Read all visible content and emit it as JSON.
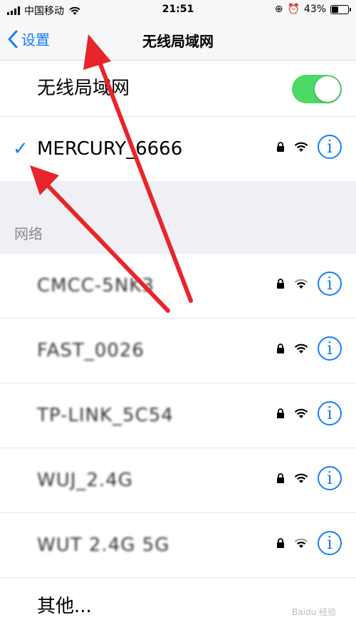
{
  "status_bar": {
    "carrier": "中国移动",
    "time": "21:51",
    "battery": "43%",
    "battery_level": 0.43
  },
  "nav": {
    "back_label": "设置",
    "title": "无线局域网"
  },
  "wifi_toggle": {
    "label": "无线局域网",
    "on": true
  },
  "connected": {
    "name": "MERCURY_6666",
    "check": "✓"
  },
  "section_header": "网络",
  "networks": [
    {
      "name": "CMCC-5NK3"
    },
    {
      "name": "FAST_0026"
    },
    {
      "name": "TP-LINK_5C54"
    },
    {
      "name": "WUJ_2.4G"
    },
    {
      "name": "WUT 2.4G 5G"
    }
  ],
  "other_label": "其他...",
  "watermark": "Baidu 经验",
  "colors": {
    "accent": "#147efb",
    "toggle_on": "#4cd964",
    "arrow": "#e8252a"
  }
}
